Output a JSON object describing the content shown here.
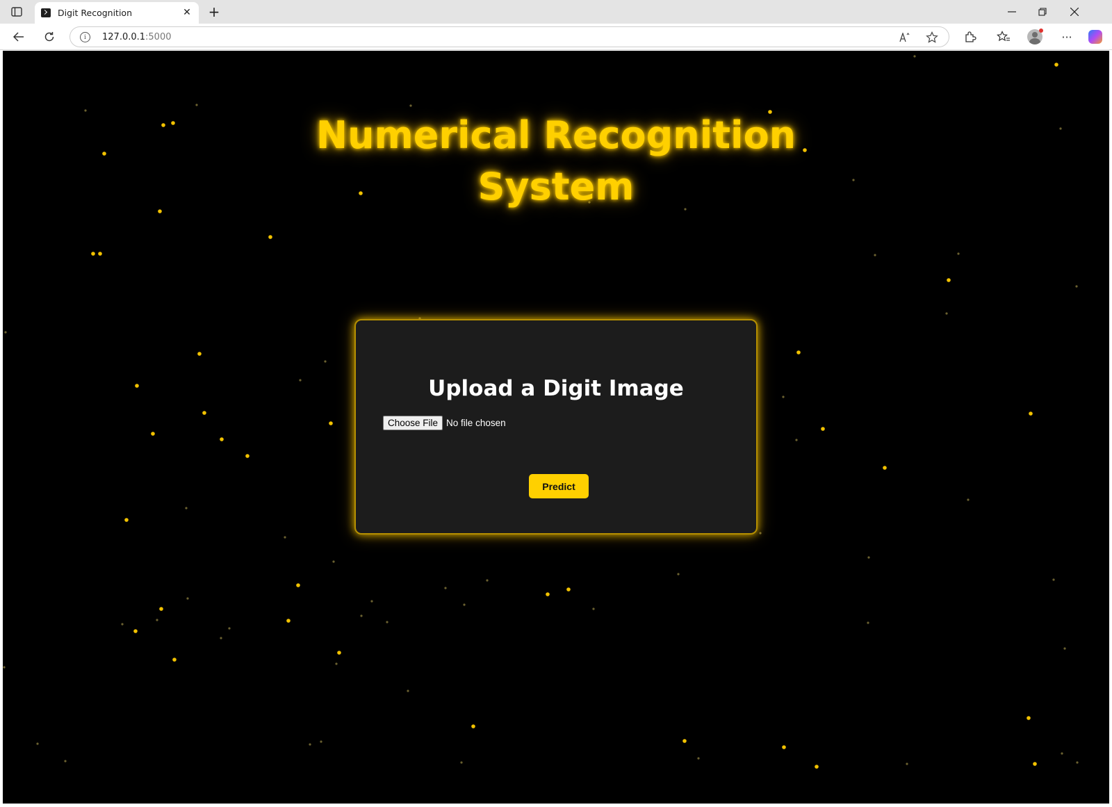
{
  "browser": {
    "tab_title": "Digit Recognition",
    "url_host": "127.0.0.1",
    "url_port": ":5000"
  },
  "page": {
    "title_line1": "Numerical Recognition",
    "title_line2": "System",
    "card_title": "Upload a Digit Image",
    "choose_file_label": "Choose File",
    "no_file_text": "No file chosen",
    "predict_label": "Predict"
  },
  "colors": {
    "accent": "#ffd000",
    "background": "#000000",
    "card": "#1c1c1c"
  }
}
